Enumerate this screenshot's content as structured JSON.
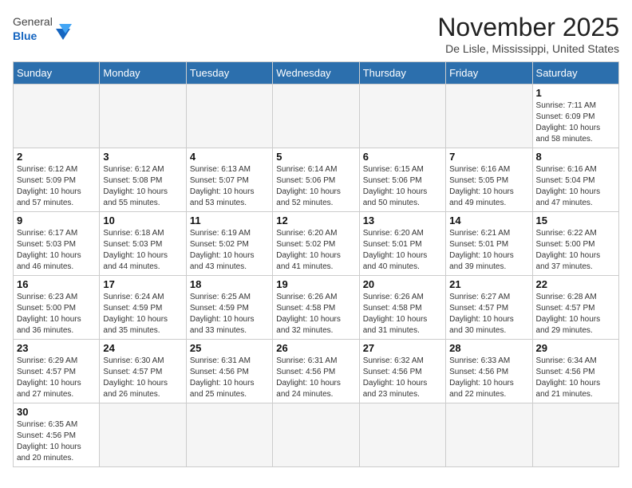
{
  "header": {
    "logo_general": "General",
    "logo_blue": "Blue",
    "month": "November 2025",
    "location": "De Lisle, Mississippi, United States"
  },
  "days_of_week": [
    "Sunday",
    "Monday",
    "Tuesday",
    "Wednesday",
    "Thursday",
    "Friday",
    "Saturday"
  ],
  "weeks": [
    [
      {
        "day": "",
        "info": ""
      },
      {
        "day": "",
        "info": ""
      },
      {
        "day": "",
        "info": ""
      },
      {
        "day": "",
        "info": ""
      },
      {
        "day": "",
        "info": ""
      },
      {
        "day": "",
        "info": ""
      },
      {
        "day": "1",
        "info": "Sunrise: 7:11 AM\nSunset: 6:09 PM\nDaylight: 10 hours and 58 minutes."
      }
    ],
    [
      {
        "day": "2",
        "info": "Sunrise: 6:12 AM\nSunset: 5:09 PM\nDaylight: 10 hours and 57 minutes."
      },
      {
        "day": "3",
        "info": "Sunrise: 6:12 AM\nSunset: 5:08 PM\nDaylight: 10 hours and 55 minutes."
      },
      {
        "day": "4",
        "info": "Sunrise: 6:13 AM\nSunset: 5:07 PM\nDaylight: 10 hours and 53 minutes."
      },
      {
        "day": "5",
        "info": "Sunrise: 6:14 AM\nSunset: 5:06 PM\nDaylight: 10 hours and 52 minutes."
      },
      {
        "day": "6",
        "info": "Sunrise: 6:15 AM\nSunset: 5:06 PM\nDaylight: 10 hours and 50 minutes."
      },
      {
        "day": "7",
        "info": "Sunrise: 6:16 AM\nSunset: 5:05 PM\nDaylight: 10 hours and 49 minutes."
      },
      {
        "day": "8",
        "info": "Sunrise: 6:16 AM\nSunset: 5:04 PM\nDaylight: 10 hours and 47 minutes."
      }
    ],
    [
      {
        "day": "9",
        "info": "Sunrise: 6:17 AM\nSunset: 5:03 PM\nDaylight: 10 hours and 46 minutes."
      },
      {
        "day": "10",
        "info": "Sunrise: 6:18 AM\nSunset: 5:03 PM\nDaylight: 10 hours and 44 minutes."
      },
      {
        "day": "11",
        "info": "Sunrise: 6:19 AM\nSunset: 5:02 PM\nDaylight: 10 hours and 43 minutes."
      },
      {
        "day": "12",
        "info": "Sunrise: 6:20 AM\nSunset: 5:02 PM\nDaylight: 10 hours and 41 minutes."
      },
      {
        "day": "13",
        "info": "Sunrise: 6:20 AM\nSunset: 5:01 PM\nDaylight: 10 hours and 40 minutes."
      },
      {
        "day": "14",
        "info": "Sunrise: 6:21 AM\nSunset: 5:01 PM\nDaylight: 10 hours and 39 minutes."
      },
      {
        "day": "15",
        "info": "Sunrise: 6:22 AM\nSunset: 5:00 PM\nDaylight: 10 hours and 37 minutes."
      }
    ],
    [
      {
        "day": "16",
        "info": "Sunrise: 6:23 AM\nSunset: 5:00 PM\nDaylight: 10 hours and 36 minutes."
      },
      {
        "day": "17",
        "info": "Sunrise: 6:24 AM\nSunset: 4:59 PM\nDaylight: 10 hours and 35 minutes."
      },
      {
        "day": "18",
        "info": "Sunrise: 6:25 AM\nSunset: 4:59 PM\nDaylight: 10 hours and 33 minutes."
      },
      {
        "day": "19",
        "info": "Sunrise: 6:26 AM\nSunset: 4:58 PM\nDaylight: 10 hours and 32 minutes."
      },
      {
        "day": "20",
        "info": "Sunrise: 6:26 AM\nSunset: 4:58 PM\nDaylight: 10 hours and 31 minutes."
      },
      {
        "day": "21",
        "info": "Sunrise: 6:27 AM\nSunset: 4:57 PM\nDaylight: 10 hours and 30 minutes."
      },
      {
        "day": "22",
        "info": "Sunrise: 6:28 AM\nSunset: 4:57 PM\nDaylight: 10 hours and 29 minutes."
      }
    ],
    [
      {
        "day": "23",
        "info": "Sunrise: 6:29 AM\nSunset: 4:57 PM\nDaylight: 10 hours and 27 minutes."
      },
      {
        "day": "24",
        "info": "Sunrise: 6:30 AM\nSunset: 4:57 PM\nDaylight: 10 hours and 26 minutes."
      },
      {
        "day": "25",
        "info": "Sunrise: 6:31 AM\nSunset: 4:56 PM\nDaylight: 10 hours and 25 minutes."
      },
      {
        "day": "26",
        "info": "Sunrise: 6:31 AM\nSunset: 4:56 PM\nDaylight: 10 hours and 24 minutes."
      },
      {
        "day": "27",
        "info": "Sunrise: 6:32 AM\nSunset: 4:56 PM\nDaylight: 10 hours and 23 minutes."
      },
      {
        "day": "28",
        "info": "Sunrise: 6:33 AM\nSunset: 4:56 PM\nDaylight: 10 hours and 22 minutes."
      },
      {
        "day": "29",
        "info": "Sunrise: 6:34 AM\nSunset: 4:56 PM\nDaylight: 10 hours and 21 minutes."
      }
    ],
    [
      {
        "day": "30",
        "info": "Sunrise: 6:35 AM\nSunset: 4:56 PM\nDaylight: 10 hours and 20 minutes."
      },
      {
        "day": "",
        "info": ""
      },
      {
        "day": "",
        "info": ""
      },
      {
        "day": "",
        "info": ""
      },
      {
        "day": "",
        "info": ""
      },
      {
        "day": "",
        "info": ""
      },
      {
        "day": "",
        "info": ""
      }
    ]
  ]
}
